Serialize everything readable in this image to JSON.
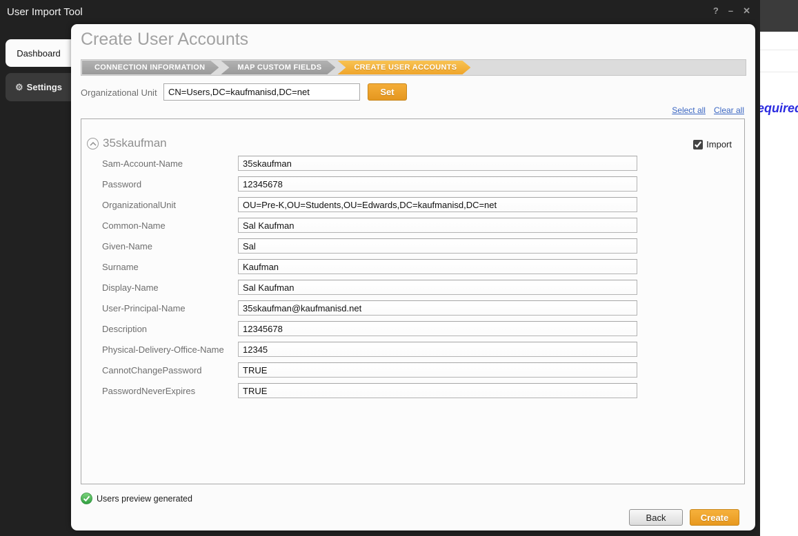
{
  "window": {
    "title": "User Import Tool",
    "controls": {
      "help": "?",
      "minimize": "–",
      "close": "✕"
    }
  },
  "sidebar": {
    "items": [
      {
        "label": "Dashboard",
        "active": true
      },
      {
        "label": "Settings",
        "icon": "gear-icon",
        "active": false
      }
    ]
  },
  "dialog": {
    "title": "Create User Accounts",
    "steps": [
      {
        "label": "CONNECTION INFORMATION",
        "state": "done"
      },
      {
        "label": "MAP CUSTOM FIELDS",
        "state": "done"
      },
      {
        "label": "CREATE USER ACCOUNTS",
        "state": "active"
      }
    ],
    "ou_field": {
      "label": "Organizational Unit",
      "value": "CN=Users,DC=kaufmanisd,DC=net",
      "set_button": "Set"
    },
    "links": {
      "select_all": "Select all",
      "clear_all": "Clear all"
    },
    "user_section": {
      "name": "35skaufman",
      "import_label": "Import",
      "import_checked": true,
      "fields": [
        {
          "label": "Sam-Account-Name",
          "value": "35skaufman"
        },
        {
          "label": "Password",
          "value": "12345678"
        },
        {
          "label": "OrganizationalUnit",
          "value": "OU=Pre-K,OU=Students,OU=Edwards,DC=kaufmanisd,DC=net"
        },
        {
          "label": "Common-Name",
          "value": "Sal Kaufman"
        },
        {
          "label": "Given-Name",
          "value": "Sal"
        },
        {
          "label": "Surname",
          "value": "Kaufman"
        },
        {
          "label": "Display-Name",
          "value": "Sal Kaufman"
        },
        {
          "label": "User-Principal-Name",
          "value": "35skaufman@kaufmanisd.net"
        },
        {
          "label": "Description",
          "value": "12345678"
        },
        {
          "label": "Physical-Delivery-Office-Name",
          "value": "12345"
        },
        {
          "label": "CannotChangePassword",
          "value": "TRUE"
        },
        {
          "label": "PasswordNeverExpires",
          "value": "TRUE"
        }
      ]
    },
    "status": "Users preview generated",
    "buttons": {
      "back": "Back",
      "create": "Create"
    }
  },
  "background_window": {
    "partial_text": "equired"
  },
  "colors": {
    "accent_orange": "#EFA52B",
    "link_blue": "#3A66C2",
    "success_green": "#3FAE49",
    "window_dark": "#212121",
    "required_blue": "#2B2BE0"
  }
}
